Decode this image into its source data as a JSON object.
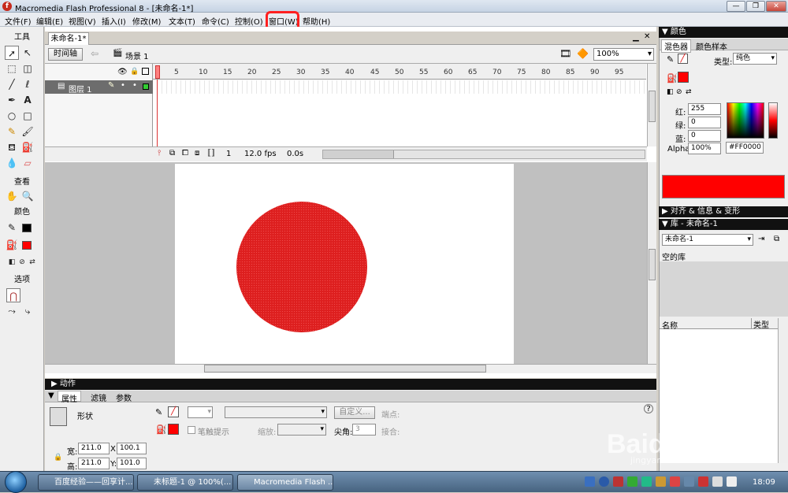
{
  "window": {
    "title": "Macromedia Flash Professional 8 - [未命名-1*]"
  },
  "menu": [
    "文件(F)",
    "编辑(E)",
    "视图(V)",
    "插入(I)",
    "修改(M)",
    "文本(T)",
    "命令(C)",
    "控制(O)",
    "窗口(W)",
    "帮助(H)"
  ],
  "toolbox": {
    "tools_label": "工具",
    "view_label": "查看",
    "colors_label": "颜色",
    "options_label": "选项"
  },
  "document": {
    "tab": "未命名-1*",
    "timeline_button": "时间轴",
    "scene": "场景 1",
    "zoom": "100%"
  },
  "timeline": {
    "layer": "图层 1",
    "ruler": [
      "5",
      "10",
      "15",
      "20",
      "25",
      "30",
      "35",
      "40",
      "45",
      "50",
      "55",
      "60",
      "65",
      "70",
      "75",
      "80",
      "85",
      "90",
      "95"
    ],
    "current_frame": "1",
    "fps": "12.0 fps",
    "time": "0.0s"
  },
  "stage": {
    "shape": "circle",
    "fill_color": "#dd1f1f"
  },
  "actions_panel": {
    "label": "动作"
  },
  "properties": {
    "tabs": [
      "属性",
      "滤镜",
      "参数"
    ],
    "shape_label": "形状",
    "width_label": "宽:",
    "width": "211.0",
    "height_label": "高:",
    "height": "211.0",
    "x_label": "X:",
    "x": "100.1",
    "y_label": "Y:",
    "y": "101.0",
    "custom_button": "自定义...",
    "endpoint_label": "端点:",
    "stroke_hint_label": "笔触提示",
    "scale_label": "缩放:",
    "miter_label": "尖角:",
    "miter_value": "3",
    "join_label": "接合:"
  },
  "color_panel": {
    "header": "颜色",
    "tabs": [
      "混色器",
      "颜色样本"
    ],
    "type_label": "类型:",
    "type_value": "纯色",
    "red_label": "红:",
    "red": "255",
    "green_label": "绿:",
    "green": "0",
    "blue_label": "蓝:",
    "blue": "0",
    "alpha_label": "Alpha:",
    "alpha": "100%",
    "hex": "#FF0000",
    "swatch_color": "#ff0000"
  },
  "align_panel": {
    "header": "对齐 & 信息 & 变形"
  },
  "library": {
    "header": "库 - 未命名-1",
    "dropdown": "未命名-1",
    "empty_text": "空的库",
    "col_name": "名称",
    "col_type": "类型"
  },
  "taskbar": {
    "items": [
      "百度经验——回享计...",
      "未标题-1 @ 100%(...",
      "Macromedia Flash ..."
    ],
    "clock": "18:09"
  },
  "watermark": {
    "text": "Baidu经验",
    "sub": "jingyan.baidu.com"
  }
}
